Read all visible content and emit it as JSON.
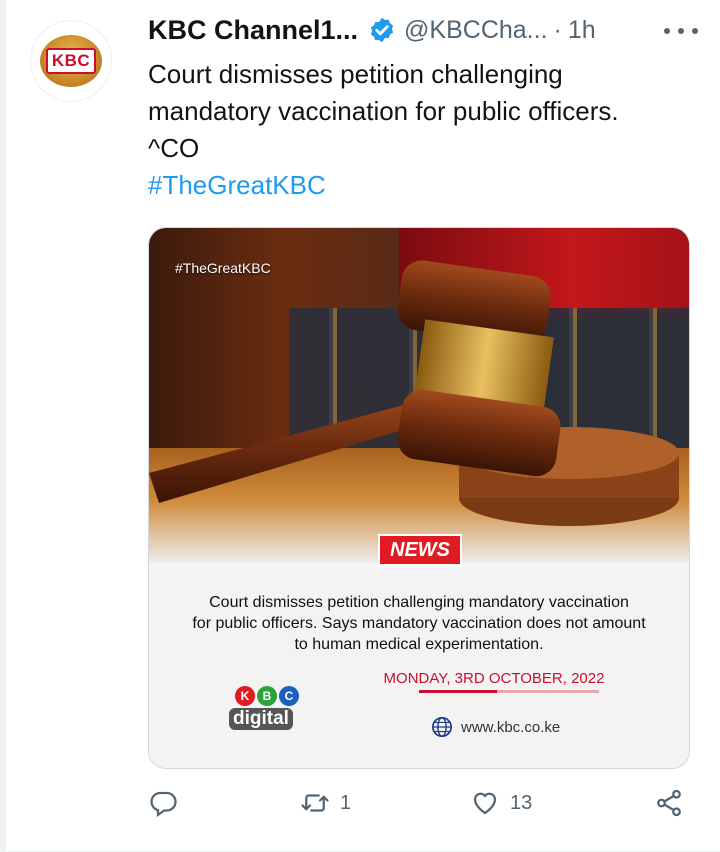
{
  "tweet": {
    "display_name": "KBC Channel1...",
    "handle": "@KBCCha...",
    "separator": "·",
    "time": "1h",
    "avatar_text": "KBC",
    "text_lines": [
      "Court dismisses petition challenging",
      "mandatory vaccination for public officers.",
      "^CO"
    ],
    "hashtag": "#TheGreatKBC"
  },
  "media": {
    "tagline": "#TheGreatKBC",
    "badge": "NEWS",
    "headline_lines": [
      "Court dismisses petition challenging mandatory vaccination",
      "for public officers. Says mandatory vaccination does not amount",
      "to human medical experimentation."
    ],
    "date": "MONDAY, 3RD OCTOBER, 2022",
    "logo_letters": [
      "K",
      "B",
      "C"
    ],
    "logo_word": "digital",
    "website": "www.kbc.co.ke"
  },
  "actions": {
    "reply_count": "",
    "retweet_count": "1",
    "like_count": "13"
  },
  "colors": {
    "link": "#1d9bf0",
    "secondary": "#536471",
    "news_red": "#e11b22"
  },
  "icons": [
    "verified-badge-icon",
    "more-options-icon",
    "reply-icon",
    "retweet-icon",
    "like-icon",
    "share-icon",
    "globe-icon"
  ]
}
